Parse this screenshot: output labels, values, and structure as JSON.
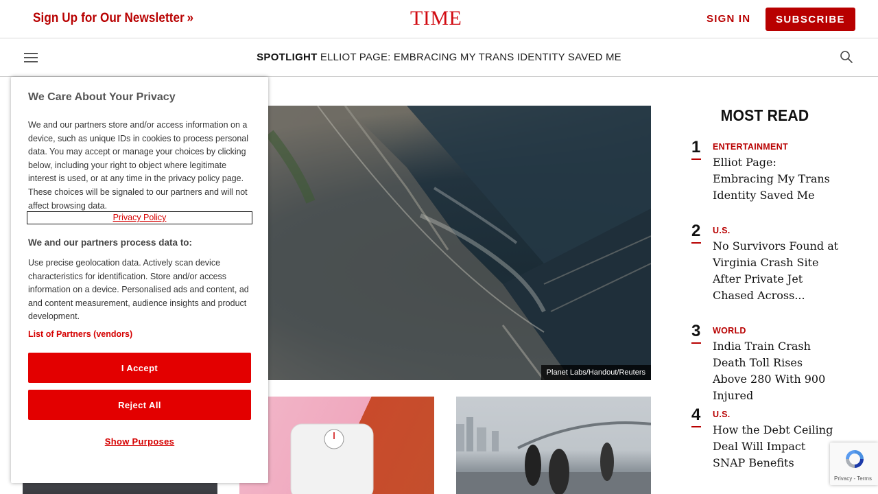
{
  "header": {
    "newsletter_label": "Sign Up for Our Newsletter",
    "newsletter_chevron": "»",
    "logo": "TIME",
    "signin_label": "SIGN IN",
    "subscribe_label": "SUBSCRIBE",
    "brand_color": "#b80000"
  },
  "spotlight": {
    "label": "SPOTLIGHT",
    "headline": "Elliot Page: Embracing My Trans Identity Saved Me"
  },
  "hero": {
    "credit": "Planet Labs/Handout/Reuters"
  },
  "most_read": {
    "title": "MOST READ",
    "items": [
      {
        "rank": "1",
        "category": "ENTERTAINMENT",
        "headline": "Elliot Page: Embracing My Trans Identity Saved Me"
      },
      {
        "rank": "2",
        "category": "U.S.",
        "headline": "No Survivors Found at Virginia Crash Site After Private Jet Chased Across..."
      },
      {
        "rank": "3",
        "category": "WORLD",
        "headline": "India Train Crash Death Toll Rises Above 280 With 900 Injured"
      },
      {
        "rank": "4",
        "category": "U.S.",
        "headline": "How the Debt Ceiling Deal Will Impact SNAP Benefits"
      }
    ]
  },
  "consent": {
    "title": "We Care About Your Privacy",
    "body": "We and our partners store and/or access information on a device, such as unique IDs in cookies to process personal data. You may accept or manage your choices by clicking below, including your right to object where legitimate interest is used, or at any time in the privacy policy page. These choices will be signaled to our partners and will not affect browsing data.",
    "privacy_link": "Privacy Policy",
    "subtitle": "We and our partners process data to:",
    "purposes": "Use precise geolocation data. Actively scan device characteristics for identification. Store and/or access information on a device. Personalised ads and content, ad and content measurement, audience insights and product development.",
    "vendors_link": "List of Partners (vendors)",
    "accept_label": "I Accept",
    "reject_label": "Reject All",
    "show_purposes_label": "Show Purposes",
    "accent_color": "#e30000"
  },
  "recaptcha": {
    "links": "Privacy - Terms"
  }
}
